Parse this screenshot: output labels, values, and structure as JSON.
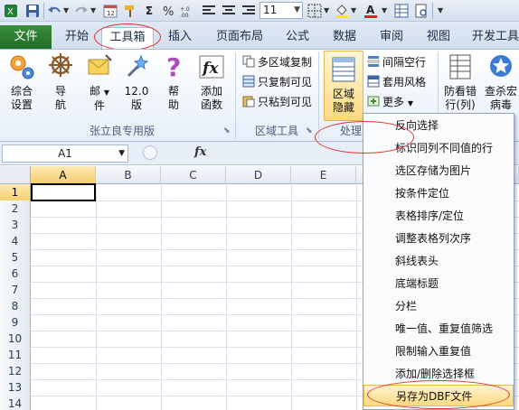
{
  "toolbar": {
    "font_size": "11"
  },
  "tabs": [
    {
      "label": "文件"
    },
    {
      "label": "开始"
    },
    {
      "label": "工具箱"
    },
    {
      "label": "插入"
    },
    {
      "label": "页面布局"
    },
    {
      "label": "公式"
    },
    {
      "label": "数据"
    },
    {
      "label": "审阅"
    },
    {
      "label": "视图"
    },
    {
      "label": "开发工具"
    }
  ],
  "ribbon": {
    "group1": {
      "label": "张立良专用版",
      "buttons": [
        {
          "label_line1": "综合",
          "label_line2": "设置",
          "icon": "gear-icon"
        },
        {
          "label_line1": "导",
          "label_line2": "航",
          "icon": "helm-icon"
        },
        {
          "label_line1": "邮",
          "label_line2": "件",
          "icon": "mail-icon"
        },
        {
          "label_line1": "12.0",
          "label_line2": "版",
          "icon": "magic-wand-icon"
        },
        {
          "label_line1": "帮",
          "label_line2": "助",
          "icon": "help-icon"
        },
        {
          "label_line1": "添加",
          "label_line2": "函数",
          "icon": "function-icon"
        }
      ]
    },
    "group2": {
      "label": "区域工具",
      "items": [
        {
          "label": "多区域复制"
        },
        {
          "label": "只复制可见"
        },
        {
          "label": "只粘到可见"
        }
      ]
    },
    "group3": {
      "label": "处理工具",
      "big_button": {
        "label_line1": "区域",
        "label_line2": "隐藏"
      },
      "items": [
        {
          "label": "间隔空行"
        },
        {
          "label": "套用风格"
        },
        {
          "label": "更多"
        }
      ]
    },
    "group4": {
      "buttons": [
        {
          "label_line1": "防看错",
          "label_line2": "行(列)"
        },
        {
          "label_line1": "查杀宏",
          "label_line2": "病毒"
        }
      ]
    }
  },
  "formula_bar": {
    "name_box": "A1",
    "fx": "fx"
  },
  "sheet": {
    "columns": [
      "A",
      "B",
      "C",
      "D",
      "E"
    ],
    "rows": [
      "1",
      "2",
      "3",
      "4",
      "5",
      "6",
      "7",
      "8",
      "9",
      "10",
      "11",
      "12",
      "13",
      "14"
    ]
  },
  "menu": {
    "items": [
      {
        "label": "反向选择"
      },
      {
        "label": "标识同列不同值的行"
      },
      {
        "label": "选区存储为图片"
      },
      {
        "label": "按条件定位"
      },
      {
        "label": "表格排序/定位"
      },
      {
        "label": "调整表格列次序"
      },
      {
        "label": "斜线表头"
      },
      {
        "label": "底端标题"
      },
      {
        "label": "分栏"
      },
      {
        "label": "唯一值、重复值筛选"
      },
      {
        "label": "限制输入重复值"
      },
      {
        "label": "添加/删除选择框"
      },
      {
        "label": "另存为DBF文件"
      }
    ]
  },
  "colors": {
    "file_tab": "#1f6d25",
    "highlight": "#fbd980",
    "annotation": "#e0332f"
  }
}
